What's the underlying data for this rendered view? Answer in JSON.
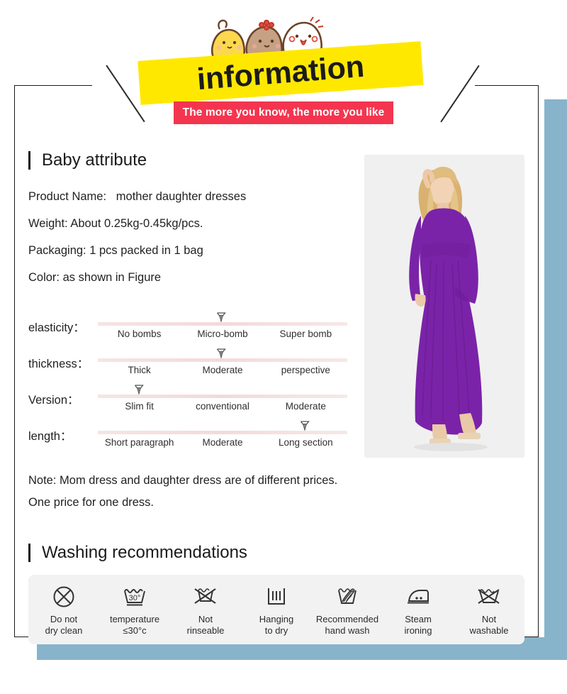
{
  "header": {
    "title": "information",
    "subtitle": "The more you know, the more you like",
    "yellow_color": "#ffe800",
    "red_color": "#f4354f",
    "mascot": "three-chicks-icon"
  },
  "frame": {
    "accent_color": "#87b4cb"
  },
  "sections": {
    "attribute_title": "Baby attribute",
    "washing_title": "Washing recommendations"
  },
  "attributes": [
    "Product Name:   mother daughter dresses",
    "Weight: About 0.25kg-0.45kg/pcs.",
    "Packaging: 1 pcs packed in 1 bag",
    "Color: as shown in Figure"
  ],
  "sliders": [
    {
      "label": "elasticity：",
      "ticks": [
        "No bombs",
        "Micro-bomb",
        "Super bomb"
      ],
      "selected_index": 1,
      "marker_position_percent": 50,
      "marker_placement": "above"
    },
    {
      "label": "thickness：",
      "ticks": [
        "Thick",
        "Moderate",
        "perspective"
      ],
      "selected_index": 1,
      "marker_position_percent": 50,
      "marker_placement": "above"
    },
    {
      "label": "Version：",
      "ticks": [
        "Slim fit",
        "conventional",
        "Moderate"
      ],
      "selected_index": 0,
      "marker_position_percent": 17,
      "marker_placement": "above"
    },
    {
      "label": "length：",
      "ticks": [
        "Short paragraph",
        "Moderate",
        "Long section"
      ],
      "selected_index": 2,
      "marker_position_percent": 83,
      "marker_placement": "above"
    }
  ],
  "photo": {
    "alt": "model-wearing-purple-maxi-dress",
    "dress_color": "#7a23a8",
    "background_color": "#f0f0f0"
  },
  "note": [
    "Note: Mom dress and daughter dress are of different prices.",
    "One price for one dress."
  ],
  "washing": [
    {
      "icon": "do-not-dry-clean-icon",
      "label": "Do not\ndry clean"
    },
    {
      "icon": "wash-temperature-30-icon",
      "label": "temperature\n≤30°c"
    },
    {
      "icon": "not-rinseable-icon",
      "label": "Not\nrinseable"
    },
    {
      "icon": "hang-to-dry-icon",
      "label": "Hanging\nto dry"
    },
    {
      "icon": "hand-wash-icon",
      "label": "Recommended\nhand wash"
    },
    {
      "icon": "steam-iron-icon",
      "label": "Steam\nironing"
    },
    {
      "icon": "not-washable-icon",
      "label": "Not\nwashable"
    }
  ]
}
